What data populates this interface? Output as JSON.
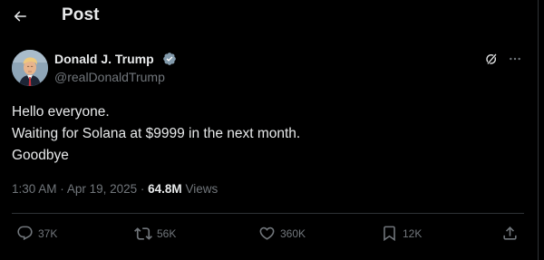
{
  "header": {
    "title": "Post",
    "back_icon": "arrow-left-icon"
  },
  "author": {
    "name": "Donald J. Trump",
    "handle": "@realDonaldTrump",
    "verified": true,
    "verified_color": "#829aab"
  },
  "tweet": {
    "lines": [
      "Hello everyone.",
      "Waiting for Solana at $9999 in the next month.",
      "Goodbye"
    ]
  },
  "meta": {
    "time": "1:30 AM",
    "separator": "·",
    "date": "Apr 19, 2025",
    "views_count": "64.8M",
    "views_label": "Views"
  },
  "actions": {
    "reply": {
      "count": "37K",
      "icon": "reply-icon"
    },
    "repost": {
      "count": "56K",
      "icon": "repost-icon"
    },
    "like": {
      "count": "360K",
      "icon": "heart-icon"
    },
    "bookmark": {
      "count": "12K",
      "icon": "bookmark-icon"
    },
    "share": {
      "icon": "share-icon"
    }
  },
  "colors": {
    "background": "#000000",
    "text": "#e7e9ea",
    "muted": "#71767b",
    "divider": "#2f3336"
  }
}
